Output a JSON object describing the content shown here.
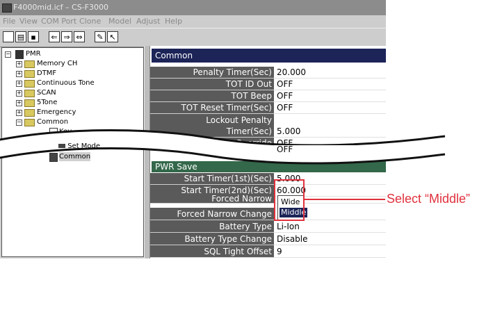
{
  "window": {
    "title": "F4000mid.icf – CS-F3000"
  },
  "menu": [
    "File",
    "View",
    "COM Port",
    "Clone",
    "Model",
    "Adjust",
    "Help"
  ],
  "tree": {
    "root": "PMR",
    "items": [
      "Memory CH",
      "DTMF",
      "Continuous Tone",
      "SCAN",
      "5Tone",
      "Emergency",
      "Common"
    ],
    "common_children": [
      "Key",
      "Set Mode",
      "Common"
    ]
  },
  "panel": {
    "common_header": "Common",
    "rows_top": [
      {
        "label": "Penalty Timer(Sec)",
        "value": "20.000"
      },
      {
        "label": "TOT ID Out",
        "value": "OFF"
      },
      {
        "label": "TOT Beep",
        "value": "OFF"
      },
      {
        "label": "TOT Reset Timer(Sec)",
        "value": "OFF"
      },
      {
        "label": "Lockout Penalty\nTimer(Sec)",
        "value": "5.000"
      },
      {
        "label": "Lockout Override",
        "value": "OFF"
      }
    ],
    "pwr_header": "PWR Save",
    "rows_bottom": [
      {
        "label": "Start Timer(1st)(Sec)",
        "value": "5.000"
      },
      {
        "label": "Start Timer(2nd)(Sec)",
        "value": "60.000"
      },
      {
        "label": "Forced Narrow",
        "value": ""
      },
      {
        "label": "Forced Narrow Change",
        "value": ""
      },
      {
        "label": "Battery Type",
        "value": "Li-Ion"
      },
      {
        "label": "Battery Type Change",
        "value": "Disable"
      },
      {
        "label": "SQL Tight Offset",
        "value": "9"
      }
    ],
    "dropdown_options": [
      "Wide",
      "Middle"
    ],
    "dropdown_selected": "Middle"
  },
  "annotation": {
    "text": "Select “Middle”",
    "color": "#e0303c"
  },
  "colors": {
    "header_common": "#1c2458",
    "header_pwr": "#33684a",
    "label_bg": "#5a5a5a"
  }
}
